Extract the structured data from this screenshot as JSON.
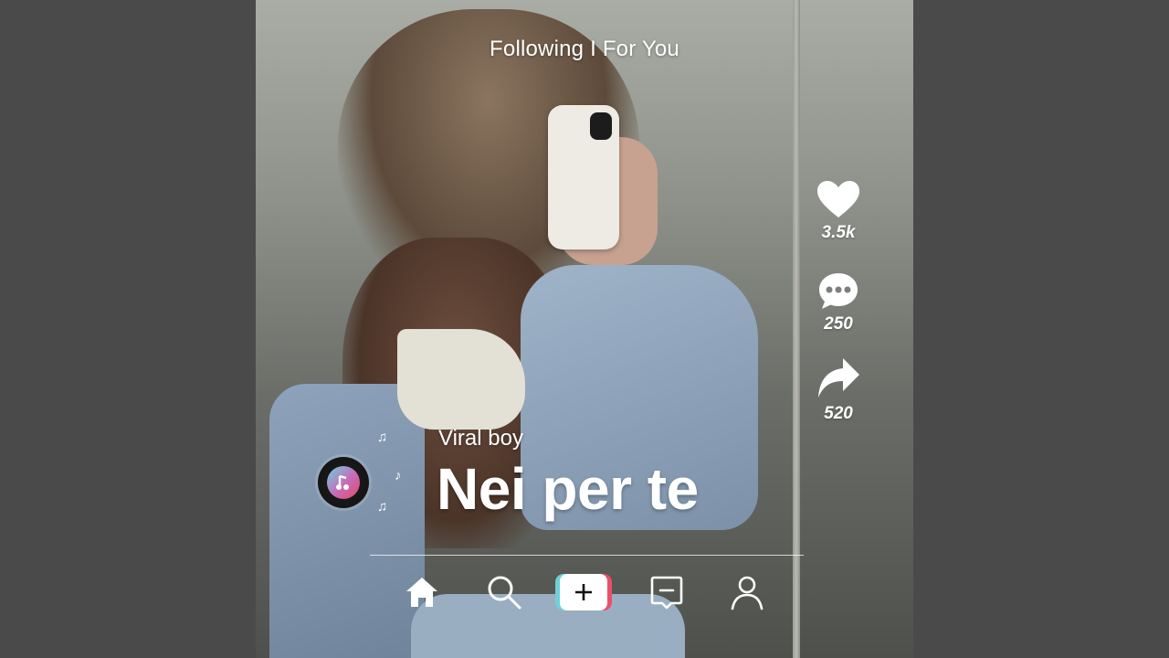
{
  "header": {
    "tabs_text": "Following I For You"
  },
  "actions": {
    "likes": "3.5k",
    "comments": "250",
    "shares": "520"
  },
  "track": {
    "artist": "Viral boy",
    "title": "Nei per te"
  },
  "nav": {
    "items": [
      {
        "icon": "home-icon"
      },
      {
        "icon": "search-icon"
      },
      {
        "icon": "plus-icon"
      },
      {
        "icon": "inbox-icon"
      },
      {
        "icon": "profile-icon"
      }
    ]
  },
  "colors": {
    "page_background": "#4a4a4a",
    "create_button_left": "#6fd0da",
    "create_button_right": "#e8506b",
    "overlay_text": "#ffffff"
  }
}
